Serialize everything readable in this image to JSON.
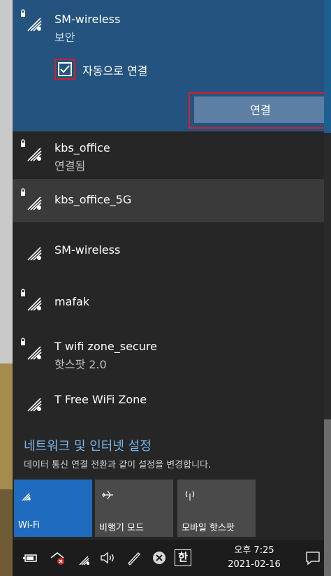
{
  "expanded_network": {
    "name": "SM-wireless",
    "status": "보안",
    "auto_connect_label": "자동으로 연결",
    "auto_connect_checked": true,
    "connect_button_label": "연결"
  },
  "networks": [
    {
      "name": "kbs_office",
      "status": "연결됨",
      "secured": true
    },
    {
      "name": "kbs_office_5G",
      "status": "",
      "secured": true
    },
    {
      "name": "SM-wireless",
      "status": "",
      "secured": false
    },
    {
      "name": "mafak",
      "status": "",
      "secured": true
    },
    {
      "name": "T wifi zone_secure",
      "status": "핫스팟 2.0",
      "secured": true
    },
    {
      "name": "T Free WiFi Zone",
      "status": "",
      "secured": false
    }
  ],
  "settings": {
    "link_label": "네트워크 및 인터넷 설정",
    "description": "데이터 통신 연결 전환과 같이 설정을 변경합니다."
  },
  "quick_actions": [
    {
      "label": "Wi-Fi",
      "icon": "wifi-icon",
      "active": true
    },
    {
      "label": "비행기 모드",
      "icon": "airplane-icon",
      "active": false
    },
    {
      "label": "모바일 핫스팟",
      "icon": "hotspot-icon",
      "active": false
    }
  ],
  "taskbar": {
    "time": "오후 7:25",
    "date": "2021-02-16",
    "ime_label": "한",
    "icons": [
      "battery-icon",
      "network-error-icon",
      "wifi-icon",
      "volume-icon",
      "pen-icon",
      "close-circle-icon",
      "ime-icon",
      "notification-icon"
    ]
  },
  "colors": {
    "expanded_bg": "#23537e",
    "panel_bg": "#262626",
    "selected_row_bg": "#3a3a3a",
    "highlight_red": "#d0202a",
    "link_blue": "#77b4ea",
    "active_tile": "#1f6bbf"
  }
}
